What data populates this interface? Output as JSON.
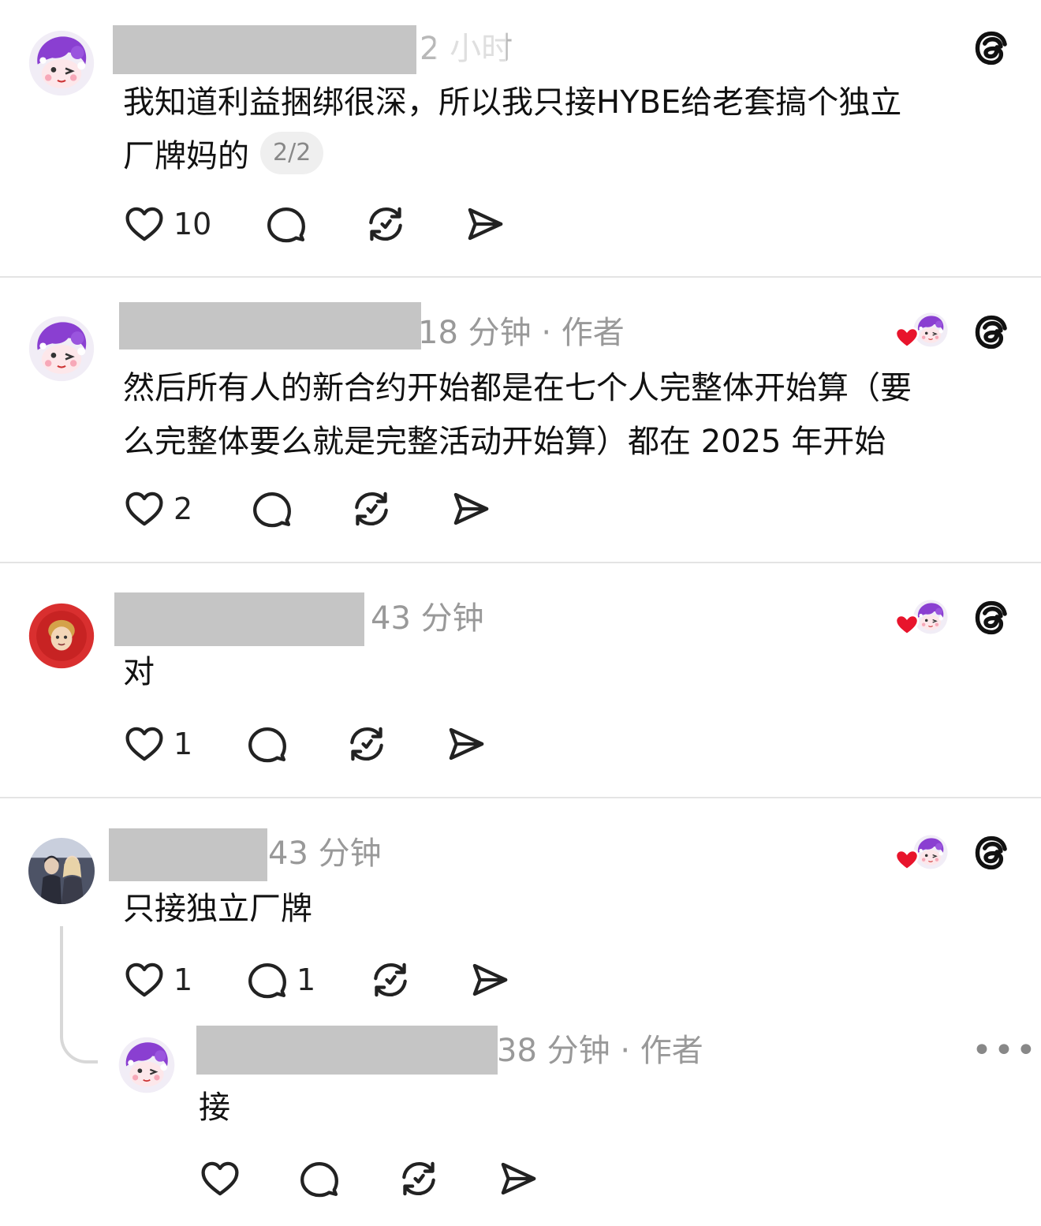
{
  "posts": [
    {
      "time": "2 小时",
      "meta_suffix": "",
      "text_lines": [
        "我知道利益捆绑很深，所以我只接HYBE给老套搞个独立",
        "厂牌妈的"
      ],
      "page_indicator": "2/2",
      "like_count": "10",
      "reply_count": "",
      "avatar": "purple-cartoon-avatar"
    },
    {
      "time": "18 分钟",
      "meta_suffix": " · 作者",
      "text_lines": [
        "然后所有人的新合约开始都是在七个人完整体开始算（要",
        "么完整体要么就是完整活动开始算）都在 2025 年开始"
      ],
      "like_count": "2",
      "reply_count": "",
      "avatar": "purple-cartoon-avatar"
    },
    {
      "time": "43 分钟",
      "meta_suffix": "",
      "text_lines": [
        "对"
      ],
      "like_count": "1",
      "reply_count": "",
      "avatar": "red-flower-avatar"
    },
    {
      "time": "43 分钟",
      "meta_suffix": "",
      "text_lines": [
        "只接独立厂牌"
      ],
      "like_count": "1",
      "reply_count": "1",
      "avatar": "concert-photo-avatar"
    },
    {
      "time": "38 分钟",
      "meta_suffix": " · 作者",
      "text_lines": [
        "接"
      ],
      "like_count": "",
      "reply_count": "",
      "avatar": "purple-cartoon-avatar",
      "more": "•••"
    }
  ],
  "colors": {
    "like_red": "#e8142c",
    "meta_gray": "#999999",
    "redaction": "#c5c5c5",
    "accent_purple": "#8a3fd1"
  },
  "icons": [
    "heart-icon",
    "comment-icon",
    "repost-icon",
    "share-icon",
    "threads-logo-icon",
    "liked-by-author-icon",
    "more-icon"
  ]
}
